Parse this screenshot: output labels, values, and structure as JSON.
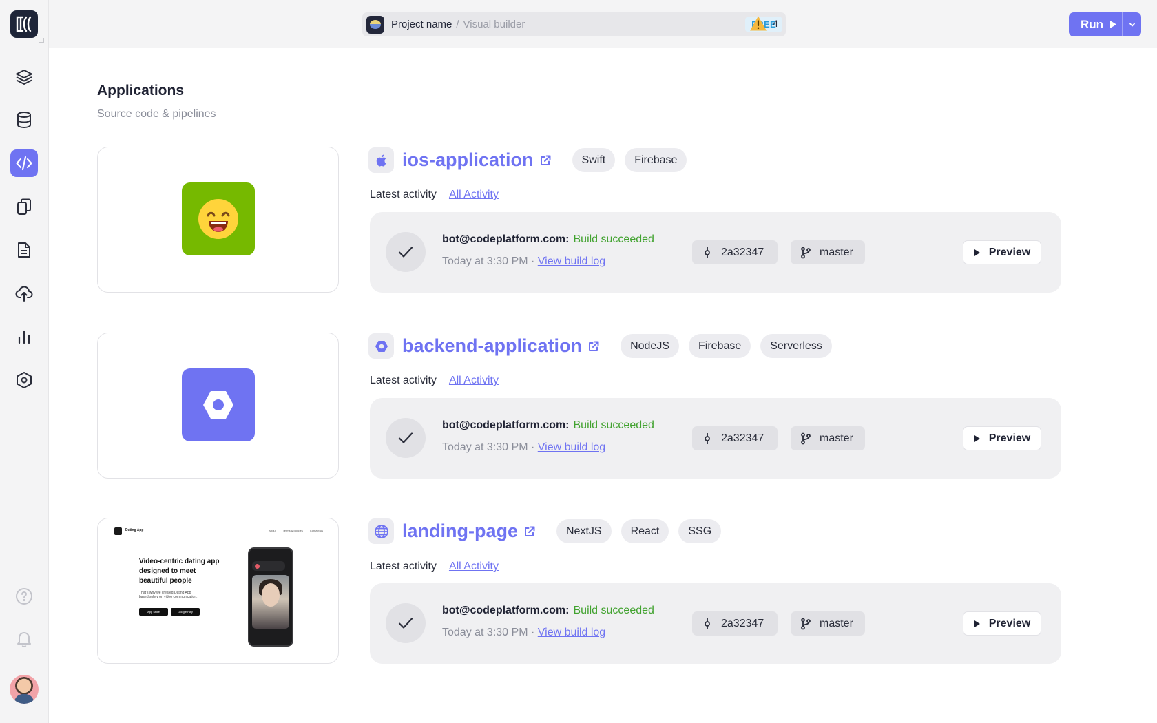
{
  "topbar": {
    "project_name": "Project name",
    "separator": "/",
    "project_sub": "Visual builder",
    "plan_badge": "FREE",
    "warnings_count": "4",
    "run_label": "Run"
  },
  "sidebar": {
    "items": [
      {
        "name": "layers",
        "icon": "layers-icon"
      },
      {
        "name": "database",
        "icon": "database-icon"
      },
      {
        "name": "code",
        "icon": "code-icon",
        "active": true
      },
      {
        "name": "screens",
        "icon": "copy-icon"
      },
      {
        "name": "documents",
        "icon": "document-icon"
      },
      {
        "name": "deploy",
        "icon": "cloud-upload-icon"
      },
      {
        "name": "analytics",
        "icon": "bar-chart-icon"
      },
      {
        "name": "settings",
        "icon": "hexagon-settings-icon"
      }
    ],
    "bottom": [
      "help-icon",
      "bell-icon",
      "avatar"
    ]
  },
  "main": {
    "title": "Applications",
    "subtitle": "Source code & pipelines",
    "latest_label": "Latest activity",
    "all_activity": "All Activity",
    "apps": [
      {
        "name": "ios-application",
        "type_icon": "apple-icon",
        "tags": [
          "Swift",
          "Firebase"
        ],
        "activity": {
          "author": "bot@codeplatform.com:",
          "status": "Build succeeded",
          "time": "Today at 3:30 PM",
          "dot": "·",
          "log_link": "View build log",
          "commit": "2a32347",
          "branch": "master",
          "preview": "Preview"
        }
      },
      {
        "name": "backend-application",
        "type_icon": "hexagon-icon",
        "tags": [
          "NodeJS",
          "Firebase",
          "Serverless"
        ],
        "activity": {
          "author": "bot@codeplatform.com:",
          "status": "Build succeeded",
          "time": "Today at 3:30 PM",
          "dot": "·",
          "log_link": "View build log",
          "commit": "2a32347",
          "branch": "master",
          "preview": "Preview"
        }
      },
      {
        "name": "landing-page",
        "type_icon": "globe-icon",
        "tags": [
          "NextJS",
          "React",
          "SSG"
        ],
        "activity": {
          "author": "bot@codeplatform.com:",
          "status": "Build succeeded",
          "time": "Today at 3:30 PM",
          "dot": "·",
          "log_link": "View build log",
          "commit": "2a32347",
          "branch": "master",
          "preview": "Preview"
        }
      }
    ],
    "landing_thumb": {
      "brand": "Dating App",
      "nav": [
        "About",
        "Terms & policies",
        "Contact us"
      ],
      "headline": "Video-centric dating app designed to meet beautiful people",
      "body": "That's why we created Dating App based solely on video communication.",
      "store_1": "App Store",
      "store_2": "Google Play"
    }
  },
  "colors": {
    "accent": "#6f73f2",
    "success": "#41a22f",
    "ios_icon_bg": "#76b900",
    "badge_text": "#2a9bd9"
  }
}
